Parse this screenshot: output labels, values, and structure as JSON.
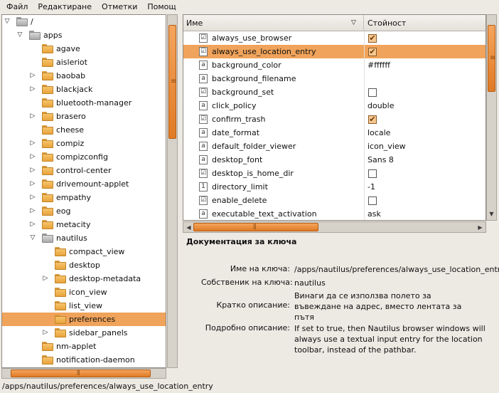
{
  "menubar": {
    "items": [
      "Файл",
      "Редактиране",
      "Отметки",
      "Помощ"
    ]
  },
  "tree": [
    {
      "label": "/",
      "depth": 0,
      "expander": "open",
      "folder": "grey"
    },
    {
      "label": "apps",
      "depth": 1,
      "expander": "open",
      "folder": "grey"
    },
    {
      "label": "agave",
      "depth": 2,
      "expander": "",
      "folder": "orange"
    },
    {
      "label": "aisleriot",
      "depth": 2,
      "expander": "",
      "folder": "orange"
    },
    {
      "label": "baobab",
      "depth": 2,
      "expander": "closed",
      "folder": "orange"
    },
    {
      "label": "blackjack",
      "depth": 2,
      "expander": "closed",
      "folder": "orange"
    },
    {
      "label": "bluetooth-manager",
      "depth": 2,
      "expander": "",
      "folder": "orange"
    },
    {
      "label": "brasero",
      "depth": 2,
      "expander": "closed",
      "folder": "orange"
    },
    {
      "label": "cheese",
      "depth": 2,
      "expander": "",
      "folder": "orange"
    },
    {
      "label": "compiz",
      "depth": 2,
      "expander": "closed",
      "folder": "orange"
    },
    {
      "label": "compizconfig",
      "depth": 2,
      "expander": "closed",
      "folder": "orange"
    },
    {
      "label": "control-center",
      "depth": 2,
      "expander": "closed",
      "folder": "orange"
    },
    {
      "label": "drivemount-applet",
      "depth": 2,
      "expander": "closed",
      "folder": "orange"
    },
    {
      "label": "empathy",
      "depth": 2,
      "expander": "closed",
      "folder": "orange"
    },
    {
      "label": "eog",
      "depth": 2,
      "expander": "closed",
      "folder": "orange"
    },
    {
      "label": "metacity",
      "depth": 2,
      "expander": "closed",
      "folder": "orange"
    },
    {
      "label": "nautilus",
      "depth": 2,
      "expander": "open",
      "folder": "grey"
    },
    {
      "label": "compact_view",
      "depth": 3,
      "expander": "",
      "folder": "orange"
    },
    {
      "label": "desktop",
      "depth": 3,
      "expander": "",
      "folder": "orange"
    },
    {
      "label": "desktop-metadata",
      "depth": 3,
      "expander": "closed",
      "folder": "orange"
    },
    {
      "label": "icon_view",
      "depth": 3,
      "expander": "",
      "folder": "orange"
    },
    {
      "label": "list_view",
      "depth": 3,
      "expander": "",
      "folder": "orange"
    },
    {
      "label": "preferences",
      "depth": 3,
      "expander": "",
      "folder": "orange",
      "selected": true
    },
    {
      "label": "sidebar_panels",
      "depth": 3,
      "expander": "closed",
      "folder": "orange"
    },
    {
      "label": "nm-applet",
      "depth": 2,
      "expander": "",
      "folder": "orange"
    },
    {
      "label": "notification-daemon",
      "depth": 2,
      "expander": "",
      "folder": "orange"
    }
  ],
  "list": {
    "col_name": "Име",
    "col_value": "Стойност",
    "rows": [
      {
        "name": "always_use_browser",
        "type": "bool",
        "value": "",
        "checked": true
      },
      {
        "name": "always_use_location_entry",
        "type": "bool",
        "value": "",
        "checked": true,
        "selected": true
      },
      {
        "name": "background_color",
        "type": "string",
        "value": "#ffffff"
      },
      {
        "name": "background_filename",
        "type": "string",
        "value": ""
      },
      {
        "name": "background_set",
        "type": "bool",
        "value": "",
        "checked": false
      },
      {
        "name": "click_policy",
        "type": "string",
        "value": "double"
      },
      {
        "name": "confirm_trash",
        "type": "bool",
        "value": "",
        "checked": true
      },
      {
        "name": "date_format",
        "type": "string",
        "value": "locale"
      },
      {
        "name": "default_folder_viewer",
        "type": "string",
        "value": "icon_view"
      },
      {
        "name": "desktop_font",
        "type": "string",
        "value": "Sans 8"
      },
      {
        "name": "desktop_is_home_dir",
        "type": "bool",
        "value": "",
        "checked": false
      },
      {
        "name": "directory_limit",
        "type": "int",
        "value": "-1"
      },
      {
        "name": "enable_delete",
        "type": "bool",
        "value": "",
        "checked": false
      },
      {
        "name": "executable_text_activation",
        "type": "string",
        "value": "ask"
      }
    ]
  },
  "doc": {
    "title": "Документация за ключа",
    "key_name_label": "Име на ключа:",
    "key_name_value": "/apps/nautilus/preferences/always_use_location_entry",
    "owner_label": "Собственик на ключа:",
    "owner_value": "nautilus",
    "short_label": "Кратко описание:",
    "short_value": "Винаги да се използва полето за въвеждане на адрес, вместо лентата за пътя",
    "long_label": "Подробно описание:",
    "long_value": "If set to true, then Nautilus browser windows will always use a textual input entry for the location toolbar, instead of the pathbar."
  },
  "statusbar": {
    "path": "/apps/nautilus/preferences/always_use_location_entry"
  },
  "icons": {
    "bool": "checkbox-key-icon",
    "string": "string-key-icon",
    "int": "integer-key-icon",
    "expander_open": "expander-open-icon",
    "expander_closed": "expander-closed-icon"
  },
  "colors": {
    "selection": "#f0a35a",
    "scroll_thumb": "#e07a25",
    "background": "#ede9e3"
  }
}
